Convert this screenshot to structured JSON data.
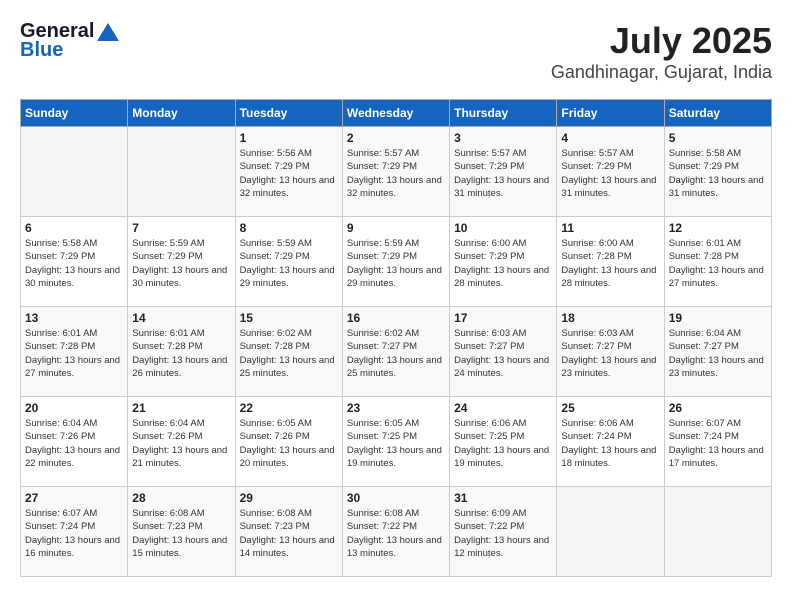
{
  "header": {
    "logo_general": "General",
    "logo_blue": "Blue",
    "month": "July 2025",
    "location": "Gandhinagar, Gujarat, India"
  },
  "days_of_week": [
    "Sunday",
    "Monday",
    "Tuesday",
    "Wednesday",
    "Thursday",
    "Friday",
    "Saturday"
  ],
  "weeks": [
    [
      {
        "day": "",
        "detail": ""
      },
      {
        "day": "",
        "detail": ""
      },
      {
        "day": "1",
        "detail": "Sunrise: 5:56 AM\nSunset: 7:29 PM\nDaylight: 13 hours\nand 32 minutes."
      },
      {
        "day": "2",
        "detail": "Sunrise: 5:57 AM\nSunset: 7:29 PM\nDaylight: 13 hours\nand 32 minutes."
      },
      {
        "day": "3",
        "detail": "Sunrise: 5:57 AM\nSunset: 7:29 PM\nDaylight: 13 hours\nand 31 minutes."
      },
      {
        "day": "4",
        "detail": "Sunrise: 5:57 AM\nSunset: 7:29 PM\nDaylight: 13 hours\nand 31 minutes."
      },
      {
        "day": "5",
        "detail": "Sunrise: 5:58 AM\nSunset: 7:29 PM\nDaylight: 13 hours\nand 31 minutes."
      }
    ],
    [
      {
        "day": "6",
        "detail": "Sunrise: 5:58 AM\nSunset: 7:29 PM\nDaylight: 13 hours\nand 30 minutes."
      },
      {
        "day": "7",
        "detail": "Sunrise: 5:59 AM\nSunset: 7:29 PM\nDaylight: 13 hours\nand 30 minutes."
      },
      {
        "day": "8",
        "detail": "Sunrise: 5:59 AM\nSunset: 7:29 PM\nDaylight: 13 hours\nand 29 minutes."
      },
      {
        "day": "9",
        "detail": "Sunrise: 5:59 AM\nSunset: 7:29 PM\nDaylight: 13 hours\nand 29 minutes."
      },
      {
        "day": "10",
        "detail": "Sunrise: 6:00 AM\nSunset: 7:29 PM\nDaylight: 13 hours\nand 28 minutes."
      },
      {
        "day": "11",
        "detail": "Sunrise: 6:00 AM\nSunset: 7:28 PM\nDaylight: 13 hours\nand 28 minutes."
      },
      {
        "day": "12",
        "detail": "Sunrise: 6:01 AM\nSunset: 7:28 PM\nDaylight: 13 hours\nand 27 minutes."
      }
    ],
    [
      {
        "day": "13",
        "detail": "Sunrise: 6:01 AM\nSunset: 7:28 PM\nDaylight: 13 hours\nand 27 minutes."
      },
      {
        "day": "14",
        "detail": "Sunrise: 6:01 AM\nSunset: 7:28 PM\nDaylight: 13 hours\nand 26 minutes."
      },
      {
        "day": "15",
        "detail": "Sunrise: 6:02 AM\nSunset: 7:28 PM\nDaylight: 13 hours\nand 25 minutes."
      },
      {
        "day": "16",
        "detail": "Sunrise: 6:02 AM\nSunset: 7:27 PM\nDaylight: 13 hours\nand 25 minutes."
      },
      {
        "day": "17",
        "detail": "Sunrise: 6:03 AM\nSunset: 7:27 PM\nDaylight: 13 hours\nand 24 minutes."
      },
      {
        "day": "18",
        "detail": "Sunrise: 6:03 AM\nSunset: 7:27 PM\nDaylight: 13 hours\nand 23 minutes."
      },
      {
        "day": "19",
        "detail": "Sunrise: 6:04 AM\nSunset: 7:27 PM\nDaylight: 13 hours\nand 23 minutes."
      }
    ],
    [
      {
        "day": "20",
        "detail": "Sunrise: 6:04 AM\nSunset: 7:26 PM\nDaylight: 13 hours\nand 22 minutes."
      },
      {
        "day": "21",
        "detail": "Sunrise: 6:04 AM\nSunset: 7:26 PM\nDaylight: 13 hours\nand 21 minutes."
      },
      {
        "day": "22",
        "detail": "Sunrise: 6:05 AM\nSunset: 7:26 PM\nDaylight: 13 hours\nand 20 minutes."
      },
      {
        "day": "23",
        "detail": "Sunrise: 6:05 AM\nSunset: 7:25 PM\nDaylight: 13 hours\nand 19 minutes."
      },
      {
        "day": "24",
        "detail": "Sunrise: 6:06 AM\nSunset: 7:25 PM\nDaylight: 13 hours\nand 19 minutes."
      },
      {
        "day": "25",
        "detail": "Sunrise: 6:06 AM\nSunset: 7:24 PM\nDaylight: 13 hours\nand 18 minutes."
      },
      {
        "day": "26",
        "detail": "Sunrise: 6:07 AM\nSunset: 7:24 PM\nDaylight: 13 hours\nand 17 minutes."
      }
    ],
    [
      {
        "day": "27",
        "detail": "Sunrise: 6:07 AM\nSunset: 7:24 PM\nDaylight: 13 hours\nand 16 minutes."
      },
      {
        "day": "28",
        "detail": "Sunrise: 6:08 AM\nSunset: 7:23 PM\nDaylight: 13 hours\nand 15 minutes."
      },
      {
        "day": "29",
        "detail": "Sunrise: 6:08 AM\nSunset: 7:23 PM\nDaylight: 13 hours\nand 14 minutes."
      },
      {
        "day": "30",
        "detail": "Sunrise: 6:08 AM\nSunset: 7:22 PM\nDaylight: 13 hours\nand 13 minutes."
      },
      {
        "day": "31",
        "detail": "Sunrise: 6:09 AM\nSunset: 7:22 PM\nDaylight: 13 hours\nand 12 minutes."
      },
      {
        "day": "",
        "detail": ""
      },
      {
        "day": "",
        "detail": ""
      }
    ]
  ]
}
